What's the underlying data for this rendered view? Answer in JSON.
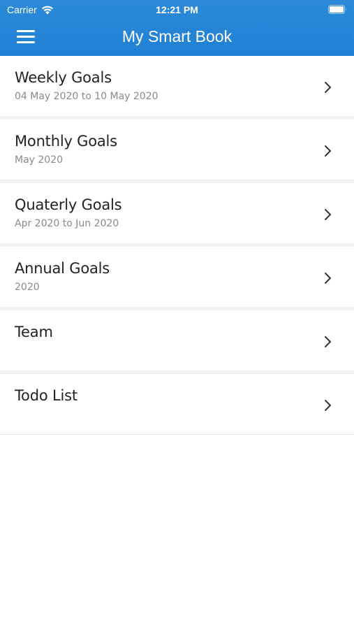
{
  "status_bar": {
    "carrier": "Carrier",
    "time": "12:21 PM"
  },
  "header": {
    "title": "My Smart Book",
    "menu_icon": "hamburger-menu-icon",
    "background": "#2184d5"
  },
  "items": [
    {
      "title": "Weekly Goals",
      "subtitle": "04 May 2020 to 10 May 2020"
    },
    {
      "title": "Monthly Goals",
      "subtitle": "May 2020"
    },
    {
      "title": "Quaterly Goals",
      "subtitle": "Apr 2020 to Jun 2020"
    },
    {
      "title": "Annual Goals",
      "subtitle": "2020"
    },
    {
      "title": "Team",
      "subtitle": ""
    },
    {
      "title": "Todo List",
      "subtitle": ""
    }
  ]
}
